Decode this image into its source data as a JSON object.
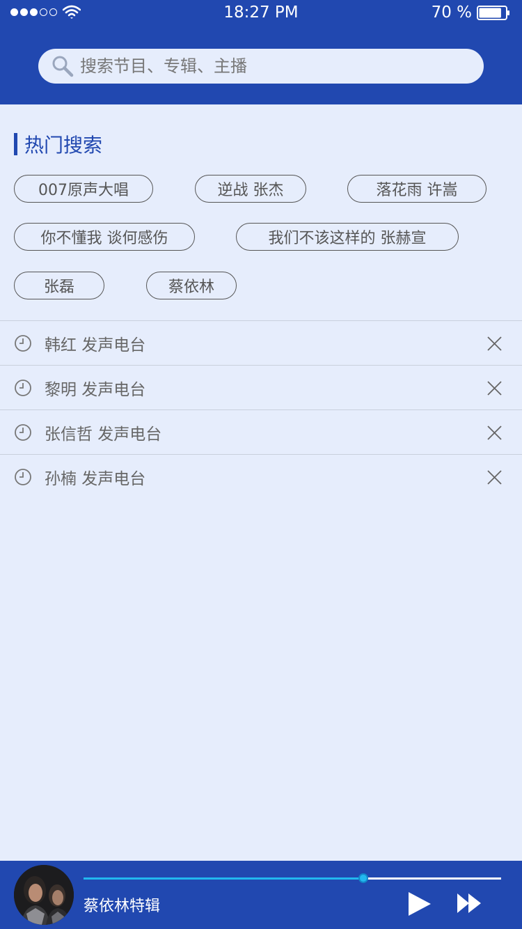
{
  "status_bar": {
    "signal_bars_filled": 3,
    "signal_bars_total": 5,
    "time": "18:27 PM",
    "battery_percent": "70 %",
    "battery_level": 0.85
  },
  "search": {
    "placeholder": "搜索节目、专辑、主播",
    "value": ""
  },
  "hot_search": {
    "title": "热门搜索",
    "tags": [
      "007原声大唱",
      "逆战 张杰",
      "落花雨 许嵩",
      "你不懂我 谈何感伤",
      "我们不该这样的 张赫宣",
      "张磊",
      "蔡依林"
    ]
  },
  "history": [
    "韩红 发声电台",
    "黎明 发声电台",
    "张信哲 发声电台",
    "孙楠 发声电台"
  ],
  "player": {
    "title": "蔡依林特辑",
    "progress": 0.67
  },
  "colors": {
    "brand_blue": "#2148b0",
    "page_background": "#e6edfc",
    "progress_cyan": "#22b8ef"
  },
  "icons": {
    "search": "search-icon",
    "history": "clock-icon",
    "remove": "close-icon",
    "play": "play-icon",
    "next": "fast-forward-icon"
  }
}
